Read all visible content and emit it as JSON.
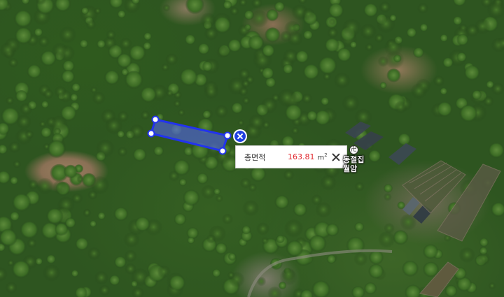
{
  "map": {
    "type": "satellite",
    "measurement": {
      "label": "총면적",
      "value": "163.81",
      "unit": "m",
      "unit_exponent": "2",
      "close_icon": "close-icon",
      "delete_icon": "delete-marker-icon"
    },
    "poi": {
      "icon": "temple-icon",
      "symbol": "卍",
      "name": "동절집\n월암"
    },
    "colors": {
      "polygon_stroke": "#2233ee",
      "polygon_fill": "#5566ff",
      "value_red": "#e0242b"
    }
  }
}
